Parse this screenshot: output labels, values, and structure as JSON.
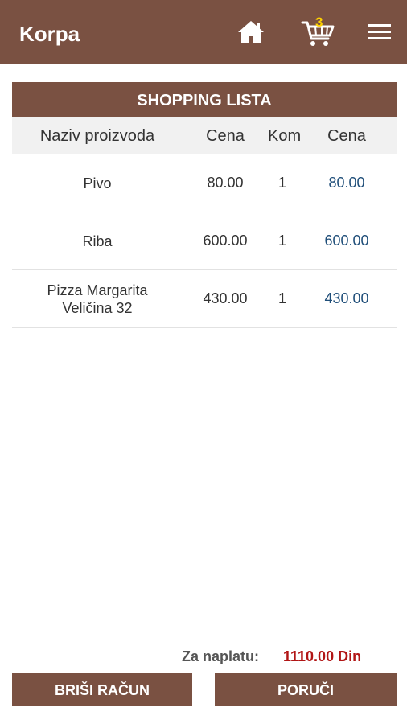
{
  "appbar": {
    "title": "Korpa",
    "cart_count": "3"
  },
  "list": {
    "title": "SHOPPING LISTA",
    "columns": [
      "Naziv proizvoda",
      "Cena",
      "Kom",
      "Cena"
    ],
    "rows": [
      {
        "name": "Pivo",
        "name_line2": "",
        "price": "80.00",
        "qty": "1",
        "total": "80.00"
      },
      {
        "name": "Riba",
        "name_line2": "",
        "price": "600.00",
        "qty": "1",
        "total": "600.00"
      },
      {
        "name": "Pizza Margarita",
        "name_line2": "Veličina 32",
        "price": "430.00",
        "qty": "1",
        "total": "430.00"
      }
    ]
  },
  "summary": {
    "label": "Za naplatu:",
    "value": "1110.00 Din"
  },
  "buttons": {
    "clear": "BRIŠI RAČUN",
    "order": "PORUČI"
  },
  "colors": {
    "brand": "#7a5142",
    "badge": "#ffd200",
    "total_text": "#1f4e79",
    "amount_due": "#b11515"
  }
}
